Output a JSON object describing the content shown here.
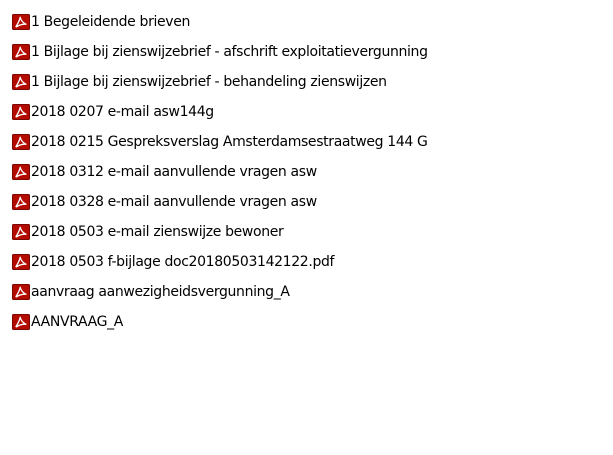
{
  "icon": "pdf-file-icon",
  "colors": {
    "pdf_icon_background": "#b30b00",
    "pdf_icon_symbol": "#ffffff",
    "text": "#000000",
    "background": "#ffffff"
  },
  "files": [
    {
      "name": "1 Begeleidende brieven"
    },
    {
      "name": "1 Bijlage bij zienswijzebrief - afschrift exploitatievergunning"
    },
    {
      "name": "1 Bijlage bij zienswijzebrief - behandeling zienswijzen"
    },
    {
      "name": "2018 0207 e-mail asw144g"
    },
    {
      "name": "2018 0215 Gespreksverslag Amsterdamsestraatweg 144 G"
    },
    {
      "name": "2018 0312 e-mail aanvullende vragen asw"
    },
    {
      "name": "2018 0328 e-mail aanvullende vragen asw"
    },
    {
      "name": "2018 0503 e-mail zienswijze bewoner"
    },
    {
      "name": "2018 0503 f-bijlage doc20180503142122.pdf"
    },
    {
      "name": "aanvraag aanwezigheidsvergunning_A"
    },
    {
      "name": "AANVRAAG_A"
    }
  ]
}
